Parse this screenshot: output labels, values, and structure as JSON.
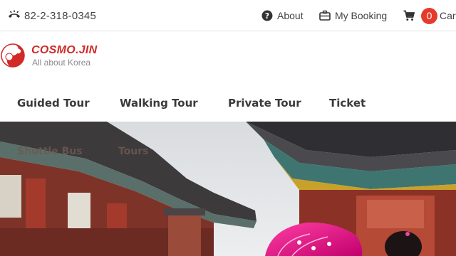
{
  "topbar": {
    "phone": "82-2-318-0345",
    "about_label": "About",
    "booking_label": "My Booking",
    "cart_count": "0",
    "cart_label": "Cart"
  },
  "brand": {
    "name": "COSMO.JIN",
    "tagline": "All about Korea",
    "accent_color": "#d12a27"
  },
  "nav": {
    "items": [
      "Guided Tour",
      "Walking Tour",
      "Private Tour",
      "Ticket"
    ],
    "overflow_items": [
      "Shuttle Bus",
      "Tours"
    ]
  },
  "icons": {
    "phone": "phone-icon",
    "about": "question-circle-icon",
    "booking": "briefcase-icon",
    "cart": "shopping-cart-icon"
  },
  "colors": {
    "cart_badge": "#e53b2c",
    "text": "#444444"
  }
}
